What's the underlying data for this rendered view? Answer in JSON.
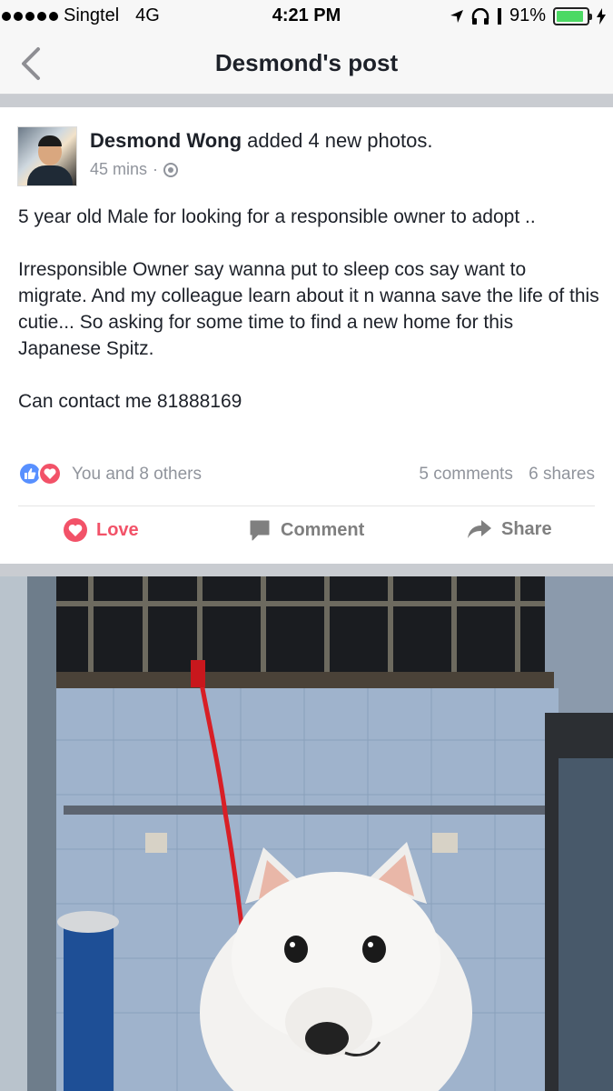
{
  "status_bar": {
    "carrier": "Singtel",
    "network": "4G",
    "time": "4:21 PM",
    "battery": "91%",
    "battery_level": 0.91
  },
  "nav": {
    "title": "Desmond's post",
    "back_icon": "chevron-left-icon"
  },
  "post": {
    "author": "Desmond Wong",
    "action_text": "added 4 new photos.",
    "time_ago": "45 mins",
    "separator": "·",
    "privacy_icon": "globe-icon",
    "paragraphs": [
      "5 year old Male for looking for a responsible owner to adopt ..",
      "Irresponsible Owner say wanna put to sleep cos say want to migrate. And my colleague learn about it n wanna save the life of this cutie... So asking for some time to find a new home for this Japanese Spitz.",
      "Can contact me 81888169"
    ],
    "reactions": {
      "icons": [
        "like-icon",
        "love-icon"
      ],
      "text": "You and 8 others",
      "comments": "5 comments",
      "shares": "6 shares"
    },
    "actions": {
      "love": "Love",
      "comment": "Comment",
      "share": "Share"
    }
  },
  "colors": {
    "love": "#f25268",
    "like": "#5890ff",
    "meta": "#90949c",
    "separator_band": "#c9ccd1"
  }
}
